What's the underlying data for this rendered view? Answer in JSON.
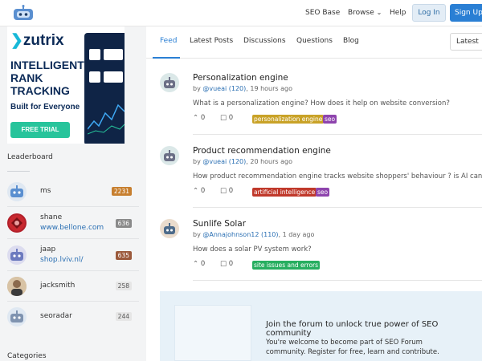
{
  "header": {
    "nav": [
      "SEO Base",
      "Browse",
      "Help"
    ],
    "login_label": "Log In",
    "signup_label": "Sign Up"
  },
  "ad": {
    "brand": "zutrix",
    "headline": "INTELLIGENT RANK TRACKING",
    "subline": "Built for Everyone",
    "cta": "FREE TRIAL"
  },
  "leaderboard": {
    "title": "Leaderboard",
    "items": [
      {
        "name": "ms",
        "link": "",
        "score": "2231",
        "score_color": "#c77f2f"
      },
      {
        "name": "shane",
        "link": "www.bellone.com",
        "score": "636",
        "score_color": "#8a8a8a"
      },
      {
        "name": "jaap",
        "link": "shop.lviv.nl/",
        "score": "635",
        "score_color": "#9b5a3c"
      },
      {
        "name": "jacksmith",
        "link": "",
        "score": "258",
        "score_color": ""
      },
      {
        "name": "seoradar",
        "link": "",
        "score": "244",
        "score_color": ""
      }
    ]
  },
  "categories": {
    "title": "Categories"
  },
  "tabs": [
    "Feed",
    "Latest Posts",
    "Discussions",
    "Questions",
    "Blog"
  ],
  "sort": {
    "value": "Latest"
  },
  "posts": [
    {
      "title": "Personalization engine",
      "meta_prefix": "by ",
      "user": "@vueai (120)",
      "time": ", 19 hours ago",
      "body": "What is a personalization engine? How does it help on website conversion?",
      "votes": "0",
      "comments": "0",
      "tags": [
        {
          "label": "personalization engine",
          "bg": "#c9a227",
          "color": "#fff"
        },
        {
          "label": "seo",
          "bg": "#8e44ad",
          "color": "#fff"
        }
      ]
    },
    {
      "title": "Product recommendation engine",
      "meta_prefix": "by ",
      "user": "@vueai (120)",
      "time": ", 20 hours ago",
      "body": "How product recommendation engine tracks website shoppers' behaviour ? is AI can rep",
      "votes": "0",
      "comments": "0",
      "tags": [
        {
          "label": "artificial intelligence",
          "bg": "#c0392b",
          "color": "#fff"
        },
        {
          "label": "seo",
          "bg": "#8e44ad",
          "color": "#fff"
        }
      ]
    },
    {
      "title": "Sunlife Solar",
      "meta_prefix": "by ",
      "user": "@Annajohnson12 (110)",
      "time": ", 1 day ago",
      "body": "How does a solar PV system work?",
      "votes": "0",
      "comments": "0",
      "tags": [
        {
          "label": "site issues and errors",
          "bg": "#27ae60",
          "color": "#fff"
        }
      ]
    }
  ],
  "join": {
    "title": "Join the forum to unlock true power of SEO community",
    "text": "You're welcome to become part of SEO Forum community. Register for free, learn and contribute."
  }
}
